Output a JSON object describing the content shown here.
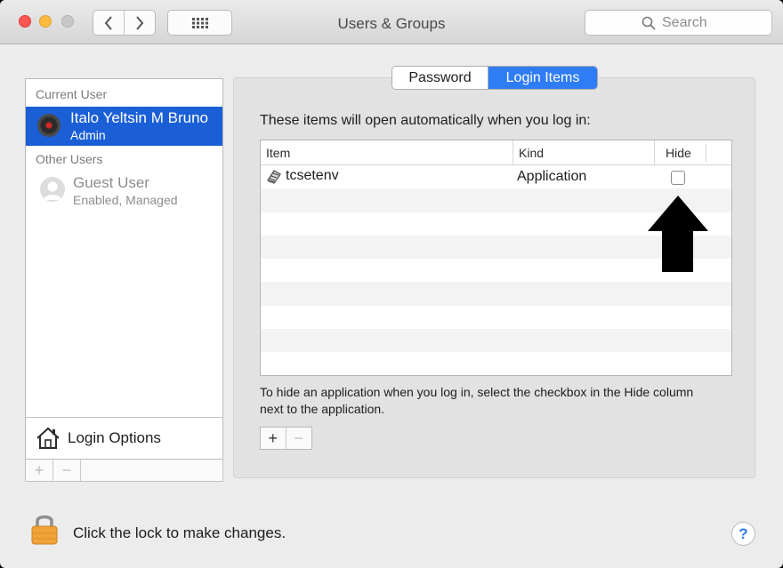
{
  "window": {
    "title": "Users & Groups",
    "search": {
      "placeholder": "Search"
    }
  },
  "sidebar": {
    "current_user_header": "Current User",
    "current_user": {
      "name": "Italo Yeltsin M Bruno",
      "role": "Admin"
    },
    "other_users_header": "Other Users",
    "other_users": [
      {
        "name": "Guest User",
        "status": "Enabled, Managed"
      }
    ],
    "login_options_label": "Login Options",
    "add_label": "+",
    "remove_label": "−"
  },
  "tabs": [
    {
      "label": "Password",
      "selected": false
    },
    {
      "label": "Login Items",
      "selected": true
    }
  ],
  "login_items": {
    "intro": "These items will open automatically when you log in:",
    "columns": [
      "Item",
      "Kind",
      "Hide"
    ],
    "rows": [
      {
        "item": "tcsetenv",
        "kind": "Application",
        "hide": false
      }
    ],
    "note": "To hide an application when you log in, select the checkbox in the Hide column next to the application.",
    "add_label": "+",
    "remove_label": "−"
  },
  "footer": {
    "lock_text": "Click the lock to make changes.",
    "help_label": "?"
  },
  "colors": {
    "accent": "#2e7cf6",
    "selection": "#1a5fd6"
  },
  "annotation": {
    "type": "arrow",
    "direction": "up",
    "color": "#000000"
  }
}
